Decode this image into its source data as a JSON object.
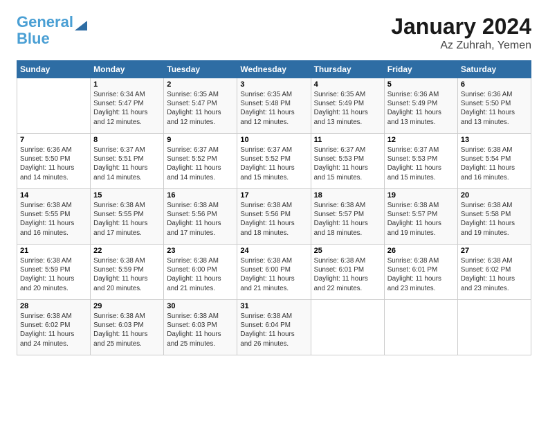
{
  "header": {
    "logo_line1": "General",
    "logo_line2": "Blue",
    "title": "January 2024",
    "subtitle": "Az Zuhrah, Yemen"
  },
  "weekdays": [
    "Sunday",
    "Monday",
    "Tuesday",
    "Wednesday",
    "Thursday",
    "Friday",
    "Saturday"
  ],
  "weeks": [
    [
      {
        "day": "",
        "info": ""
      },
      {
        "day": "1",
        "info": "Sunrise: 6:34 AM\nSunset: 5:47 PM\nDaylight: 11 hours\nand 12 minutes."
      },
      {
        "day": "2",
        "info": "Sunrise: 6:35 AM\nSunset: 5:47 PM\nDaylight: 11 hours\nand 12 minutes."
      },
      {
        "day": "3",
        "info": "Sunrise: 6:35 AM\nSunset: 5:48 PM\nDaylight: 11 hours\nand 12 minutes."
      },
      {
        "day": "4",
        "info": "Sunrise: 6:35 AM\nSunset: 5:49 PM\nDaylight: 11 hours\nand 13 minutes."
      },
      {
        "day": "5",
        "info": "Sunrise: 6:36 AM\nSunset: 5:49 PM\nDaylight: 11 hours\nand 13 minutes."
      },
      {
        "day": "6",
        "info": "Sunrise: 6:36 AM\nSunset: 5:50 PM\nDaylight: 11 hours\nand 13 minutes."
      }
    ],
    [
      {
        "day": "7",
        "info": "Sunrise: 6:36 AM\nSunset: 5:50 PM\nDaylight: 11 hours\nand 14 minutes."
      },
      {
        "day": "8",
        "info": "Sunrise: 6:37 AM\nSunset: 5:51 PM\nDaylight: 11 hours\nand 14 minutes."
      },
      {
        "day": "9",
        "info": "Sunrise: 6:37 AM\nSunset: 5:52 PM\nDaylight: 11 hours\nand 14 minutes."
      },
      {
        "day": "10",
        "info": "Sunrise: 6:37 AM\nSunset: 5:52 PM\nDaylight: 11 hours\nand 15 minutes."
      },
      {
        "day": "11",
        "info": "Sunrise: 6:37 AM\nSunset: 5:53 PM\nDaylight: 11 hours\nand 15 minutes."
      },
      {
        "day": "12",
        "info": "Sunrise: 6:37 AM\nSunset: 5:53 PM\nDaylight: 11 hours\nand 15 minutes."
      },
      {
        "day": "13",
        "info": "Sunrise: 6:38 AM\nSunset: 5:54 PM\nDaylight: 11 hours\nand 16 minutes."
      }
    ],
    [
      {
        "day": "14",
        "info": "Sunrise: 6:38 AM\nSunset: 5:55 PM\nDaylight: 11 hours\nand 16 minutes."
      },
      {
        "day": "15",
        "info": "Sunrise: 6:38 AM\nSunset: 5:55 PM\nDaylight: 11 hours\nand 17 minutes."
      },
      {
        "day": "16",
        "info": "Sunrise: 6:38 AM\nSunset: 5:56 PM\nDaylight: 11 hours\nand 17 minutes."
      },
      {
        "day": "17",
        "info": "Sunrise: 6:38 AM\nSunset: 5:56 PM\nDaylight: 11 hours\nand 18 minutes."
      },
      {
        "day": "18",
        "info": "Sunrise: 6:38 AM\nSunset: 5:57 PM\nDaylight: 11 hours\nand 18 minutes."
      },
      {
        "day": "19",
        "info": "Sunrise: 6:38 AM\nSunset: 5:57 PM\nDaylight: 11 hours\nand 19 minutes."
      },
      {
        "day": "20",
        "info": "Sunrise: 6:38 AM\nSunset: 5:58 PM\nDaylight: 11 hours\nand 19 minutes."
      }
    ],
    [
      {
        "day": "21",
        "info": "Sunrise: 6:38 AM\nSunset: 5:59 PM\nDaylight: 11 hours\nand 20 minutes."
      },
      {
        "day": "22",
        "info": "Sunrise: 6:38 AM\nSunset: 5:59 PM\nDaylight: 11 hours\nand 20 minutes."
      },
      {
        "day": "23",
        "info": "Sunrise: 6:38 AM\nSunset: 6:00 PM\nDaylight: 11 hours\nand 21 minutes."
      },
      {
        "day": "24",
        "info": "Sunrise: 6:38 AM\nSunset: 6:00 PM\nDaylight: 11 hours\nand 21 minutes."
      },
      {
        "day": "25",
        "info": "Sunrise: 6:38 AM\nSunset: 6:01 PM\nDaylight: 11 hours\nand 22 minutes."
      },
      {
        "day": "26",
        "info": "Sunrise: 6:38 AM\nSunset: 6:01 PM\nDaylight: 11 hours\nand 23 minutes."
      },
      {
        "day": "27",
        "info": "Sunrise: 6:38 AM\nSunset: 6:02 PM\nDaylight: 11 hours\nand 23 minutes."
      }
    ],
    [
      {
        "day": "28",
        "info": "Sunrise: 6:38 AM\nSunset: 6:02 PM\nDaylight: 11 hours\nand 24 minutes."
      },
      {
        "day": "29",
        "info": "Sunrise: 6:38 AM\nSunset: 6:03 PM\nDaylight: 11 hours\nand 25 minutes."
      },
      {
        "day": "30",
        "info": "Sunrise: 6:38 AM\nSunset: 6:03 PM\nDaylight: 11 hours\nand 25 minutes."
      },
      {
        "day": "31",
        "info": "Sunrise: 6:38 AM\nSunset: 6:04 PM\nDaylight: 11 hours\nand 26 minutes."
      },
      {
        "day": "",
        "info": ""
      },
      {
        "day": "",
        "info": ""
      },
      {
        "day": "",
        "info": ""
      }
    ]
  ]
}
